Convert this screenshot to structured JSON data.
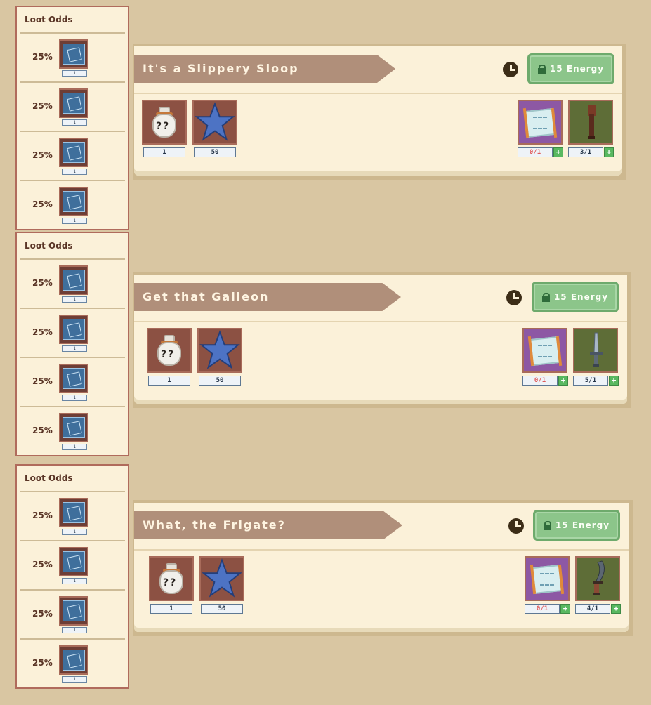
{
  "loot_panels": [
    {
      "title": "Loot Odds",
      "rows": [
        {
          "odds": "25%",
          "icon": "blueprint-icon",
          "count": "1"
        },
        {
          "odds": "25%",
          "icon": "blueprint-icon",
          "count": "1"
        },
        {
          "odds": "25%",
          "icon": "blueprint-icon",
          "count": "1"
        },
        {
          "odds": "25%",
          "icon": "blueprint-icon",
          "count": "1"
        }
      ]
    },
    {
      "title": "Loot Odds",
      "rows": [
        {
          "odds": "25%",
          "icon": "blueprint-icon",
          "count": "1"
        },
        {
          "odds": "25%",
          "icon": "blueprint-icon",
          "count": "1"
        },
        {
          "odds": "25%",
          "icon": "blueprint-icon",
          "count": "1"
        },
        {
          "odds": "25%",
          "icon": "blueprint-icon",
          "count": "1"
        }
      ]
    },
    {
      "title": "Loot Odds",
      "rows": [
        {
          "odds": "25%",
          "icon": "blueprint-icon",
          "count": "1"
        },
        {
          "odds": "25%",
          "icon": "blueprint-icon",
          "count": "1"
        },
        {
          "odds": "25%",
          "icon": "blueprint-icon",
          "count": "1"
        },
        {
          "odds": "25%",
          "icon": "blueprint-icon",
          "count": "1"
        }
      ]
    }
  ],
  "quests": [
    {
      "title": "It's a Slippery Sloop",
      "energy_label": "15 Energy",
      "rewards": [
        {
          "icon": "mystery-bag-icon",
          "count": "1"
        },
        {
          "icon": "star-icon",
          "count": "50"
        }
      ],
      "requirements": [
        {
          "icon": "treasure-map-icon",
          "count": "0/1",
          "met": false
        },
        {
          "icon": "wooden-club-icon",
          "count": "3/1",
          "met": true
        }
      ]
    },
    {
      "title": "Get that Galleon",
      "energy_label": "15 Energy",
      "rewards": [
        {
          "icon": "mystery-bag-icon",
          "count": "1"
        },
        {
          "icon": "star-icon",
          "count": "50"
        }
      ],
      "requirements": [
        {
          "icon": "treasure-map-icon",
          "count": "0/1",
          "met": false
        },
        {
          "icon": "dagger-icon",
          "count": "5/1",
          "met": true
        }
      ]
    },
    {
      "title": "What, the Frigate?",
      "energy_label": "15 Energy",
      "rewards": [
        {
          "icon": "mystery-bag-icon",
          "count": "1"
        },
        {
          "icon": "star-icon",
          "count": "50"
        }
      ],
      "requirements": [
        {
          "icon": "treasure-map-icon",
          "count": "0/1",
          "met": false
        },
        {
          "icon": "cutlass-icon",
          "count": "4/1",
          "met": true
        }
      ]
    }
  ],
  "colors": {
    "background": "#d9c6a2",
    "panel": "#fbf1d9",
    "banner": "#b08f7a",
    "energy_button": "#8cc58a",
    "unmet_count": "#e05b5b"
  }
}
